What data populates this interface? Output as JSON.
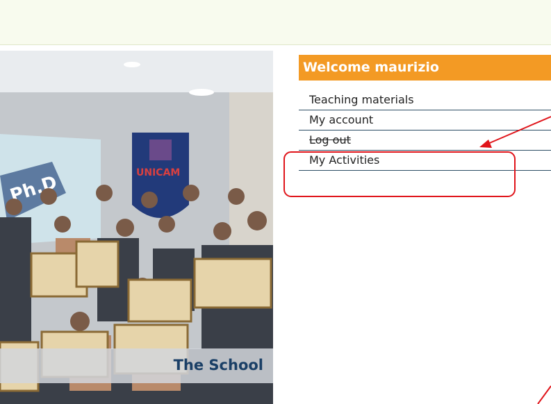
{
  "panel": {
    "welcome": "Welcome maurizio",
    "menu": [
      {
        "label": "Teaching materials"
      },
      {
        "label": "My account"
      },
      {
        "label": "Log out"
      },
      {
        "label": "My Activities"
      }
    ]
  },
  "photo": {
    "caption": "The School",
    "banner_text": "Ph.D",
    "seal_text": "UNICAM"
  },
  "colors": {
    "header": "#f39a24",
    "top_band": "#f8fbee",
    "annotation": "#e0141a",
    "caption_text": "#1a3f66"
  }
}
